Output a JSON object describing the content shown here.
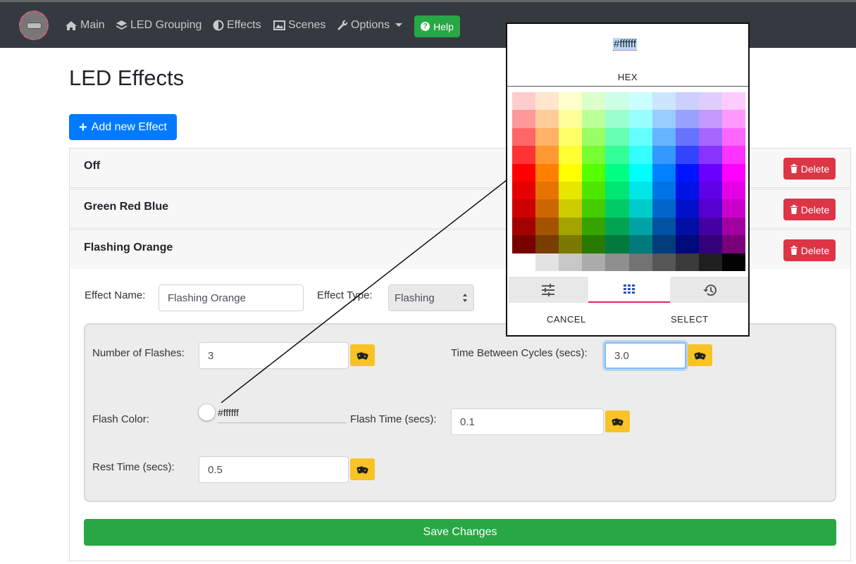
{
  "nav": {
    "items": [
      {
        "label": "Main",
        "icon": "home-icon"
      },
      {
        "label": "LED Grouping",
        "icon": "layers-icon"
      },
      {
        "label": "Effects",
        "icon": "adjust-icon"
      },
      {
        "label": "Scenes",
        "icon": "image-icon"
      },
      {
        "label": "Options",
        "icon": "wrench-icon"
      }
    ],
    "help_label": "Help"
  },
  "page": {
    "title": "LED Effects",
    "add_button": "Add new Effect"
  },
  "effects": [
    {
      "name": "Off",
      "delete_label": "Delete"
    },
    {
      "name": "Green Red Blue",
      "delete_label": "Delete"
    },
    {
      "name": "Flashing Orange",
      "delete_label": "Delete"
    }
  ],
  "form": {
    "effect_name_label": "Effect Name:",
    "effect_name_value": "Flashing Orange",
    "effect_type_label": "Effect Type:",
    "effect_type_value": "Flashing",
    "num_flashes_label": "Number of Flashes:",
    "num_flashes_value": "3",
    "time_between_label": "Time Between Cycles (secs):",
    "time_between_value": "3.0",
    "flash_color_label": "Flash Color:",
    "flash_color_value": "#ffffff",
    "flash_time_label": "Flash Time (secs):",
    "flash_time_value": "0.1",
    "rest_time_label": "Rest Time (secs):",
    "rest_time_value": "0.5",
    "save_label": "Save Changes"
  },
  "picker": {
    "hex_value": "#ffffff",
    "hex_label": "HEX",
    "cancel_label": "CANCEL",
    "select_label": "SELECT"
  },
  "colors": {
    "navbar": "#343a40",
    "primary": "#007bff",
    "success": "#28a745",
    "danger": "#dc3545",
    "warning": "#f7c325"
  }
}
